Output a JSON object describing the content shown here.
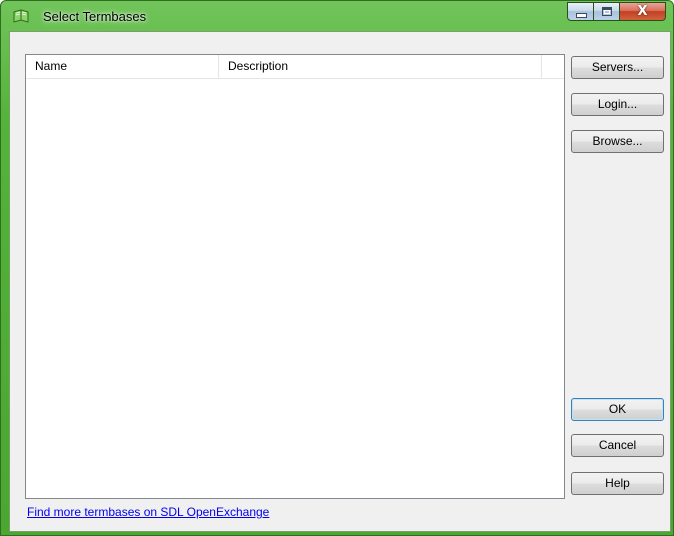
{
  "window": {
    "title": "Select Termbases",
    "icon": "termbase-book-icon",
    "caption": {
      "minimize": "",
      "maximize": "",
      "close": "X"
    }
  },
  "list": {
    "columns": [
      "Name",
      "Description"
    ],
    "rows": []
  },
  "buttons": {
    "servers": "Servers...",
    "login": "Login...",
    "browse": "Browse...",
    "ok": "OK",
    "cancel": "Cancel",
    "help": "Help"
  },
  "footer": {
    "link": "Find more termbases on SDL OpenExchange"
  },
  "colors": {
    "frame": "#53b33a",
    "link": "#0000ee",
    "default_button_border": "#3c7fb1"
  }
}
